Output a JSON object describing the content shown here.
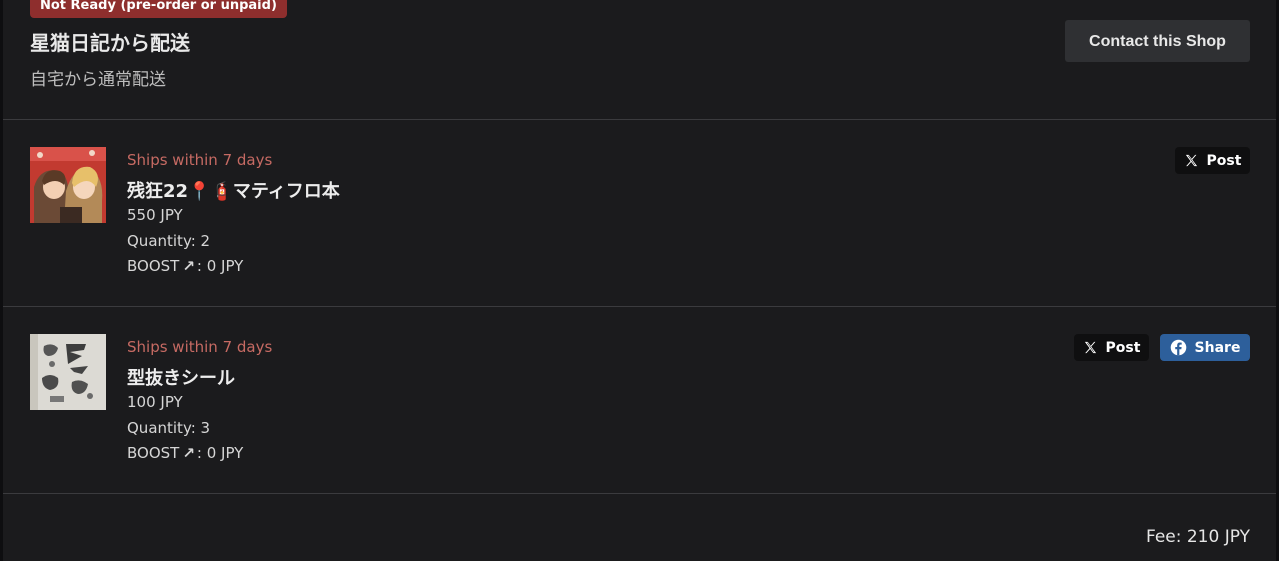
{
  "header": {
    "status_badge": "Not Ready (pre-order or unpaid)",
    "shop_name": "星猫日記から配送",
    "shipping_method": "自宅から通常配送",
    "contact_label": "Contact this Shop"
  },
  "items": [
    {
      "ships": "Ships within 7 days",
      "title": "残狂22📍🧯マティフロ本",
      "price": "550 JPY",
      "quantity": "Quantity: 2",
      "boost_label": "BOOST",
      "boost_value": ": 0 JPY",
      "post_label": "Post"
    },
    {
      "ships": "Ships within 7 days",
      "title": "型抜きシール",
      "price": "100 JPY",
      "quantity": "Quantity: 3",
      "boost_label": "BOOST",
      "boost_value": ": 0 JPY",
      "post_label": "Post",
      "share_label": "Share"
    }
  ],
  "footer": {
    "fee": "Fee: 210 JPY"
  },
  "colors": {
    "background": "#1b1b1d",
    "badge": "#8e2e2d",
    "ships_text": "#c66a63",
    "facebook": "#2d5f9b"
  },
  "icons": {
    "boost": "arrow-up-right-icon",
    "post": "x-logo-icon",
    "share": "facebook-icon"
  }
}
